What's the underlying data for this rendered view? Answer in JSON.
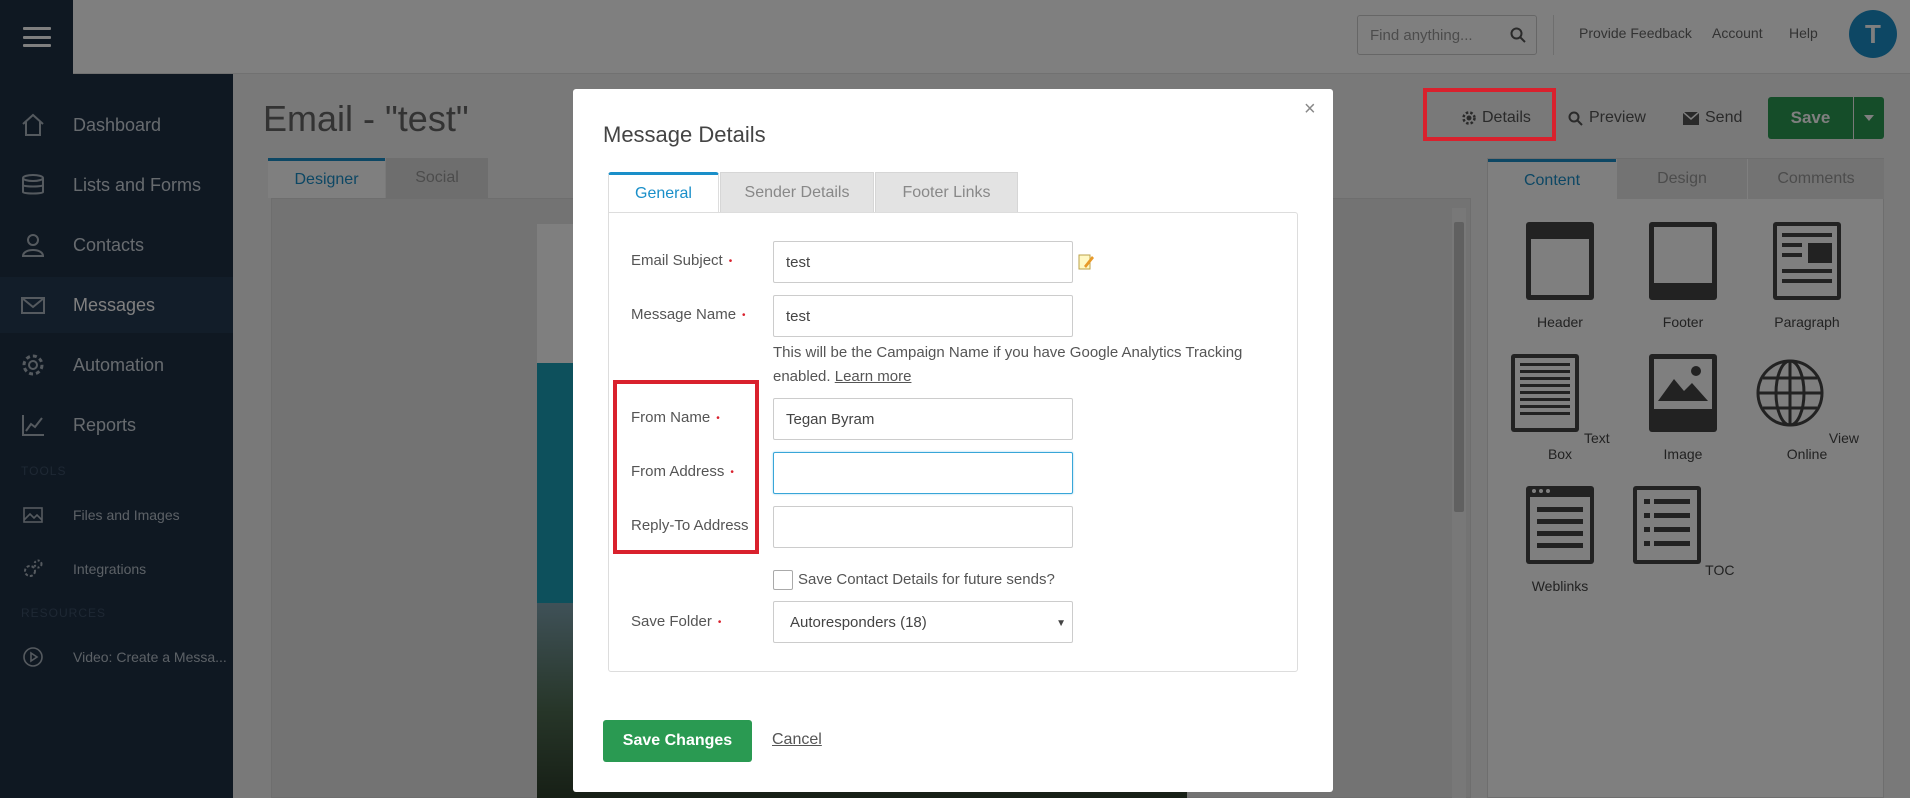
{
  "topbar": {
    "search_placeholder": "Find anything...",
    "links": [
      "Provide Feedback",
      "Account",
      "Help"
    ],
    "avatar_letter": "T"
  },
  "sidebar": {
    "items": [
      {
        "label": "Dashboard",
        "icon": "home-icon"
      },
      {
        "label": "Lists and Forms",
        "icon": "database-icon"
      },
      {
        "label": "Contacts",
        "icon": "user-icon"
      },
      {
        "label": "Messages",
        "icon": "envelope-icon",
        "active": true
      },
      {
        "label": "Automation",
        "icon": "gear-icon"
      },
      {
        "label": "Reports",
        "icon": "line-chart-icon"
      }
    ],
    "tools_heading": "TOOLS",
    "tools": [
      {
        "label": "Files and Images",
        "icon": "image-icon"
      },
      {
        "label": "Integrations",
        "icon": "cogs-icon"
      }
    ],
    "resources_heading": "RESOURCES",
    "resources": [
      {
        "label": "Video: Create a Messa...",
        "icon": "play-circle-icon"
      }
    ]
  },
  "main": {
    "title": "Email - \"test\"",
    "toolbar": {
      "details": "Details",
      "preview": "Preview",
      "send": "Send",
      "save": "Save"
    },
    "left_tabs": [
      "Designer",
      "Social"
    ],
    "right_tabs": [
      "Content",
      "Design",
      "Comments"
    ],
    "blocks": [
      "Header",
      "Footer",
      "Paragraph",
      "Text Box",
      "Image",
      "View Online",
      "Weblinks",
      "TOC"
    ]
  },
  "modal": {
    "title": "Message Details",
    "close": "×",
    "tabs": [
      "General",
      "Sender Details",
      "Footer Links"
    ],
    "fields": {
      "email_subject": {
        "label": "Email Subject",
        "value": "test"
      },
      "message_name": {
        "label": "Message Name",
        "value": "test"
      },
      "from_name": {
        "label": "From Name",
        "value": "Tegan Byram"
      },
      "from_address": {
        "label": "From Address",
        "value": ""
      },
      "reply_to": {
        "label": "Reply-To Address",
        "value": ""
      }
    },
    "help_text": "This will be the Campaign Name if you have Google Analytics Tracking enabled.",
    "help_link": "Learn more",
    "checkbox_label": "Save Contact Details for future sends?",
    "save_folder": {
      "label": "Save Folder",
      "value": "Autoresponders  (18)"
    },
    "save_button": "Save Changes",
    "cancel_link": "Cancel"
  },
  "colors": {
    "sidebar_bg": "#1f3044",
    "accent": "#1a8fc9",
    "primary_green": "#2a9a52",
    "highlight_red": "#d9212d"
  }
}
